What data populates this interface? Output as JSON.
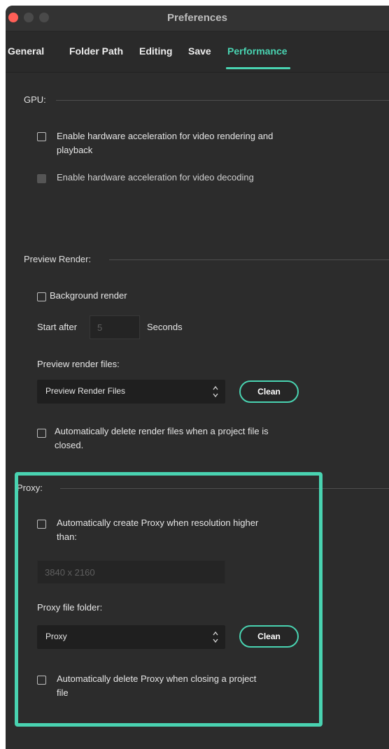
{
  "window": {
    "title": "Preferences"
  },
  "tabs": [
    {
      "label": "General",
      "active": false
    },
    {
      "label": "Folder Path",
      "active": false
    },
    {
      "label": "Editing",
      "active": false
    },
    {
      "label": "Save",
      "active": false
    },
    {
      "label": "Performance",
      "active": true
    }
  ],
  "gpu": {
    "label": "GPU:",
    "options": [
      {
        "label": "Enable hardware acceleration for video rendering and playback",
        "checked": false,
        "enabled": true
      },
      {
        "label": "Enable hardware acceleration for video decoding",
        "checked": false,
        "enabled": false
      }
    ]
  },
  "preview_render": {
    "label": "Preview Render:",
    "background_render": {
      "label": "Background render",
      "checked": false
    },
    "start_after_label": "Start after",
    "start_after_value": "5",
    "seconds_label": "Seconds",
    "files_label": "Preview render files:",
    "files_value": "Preview Render Files",
    "clean_label": "Clean",
    "auto_delete": {
      "label": "Automatically delete render files when a project file is closed.",
      "checked": false
    }
  },
  "proxy": {
    "label": "Proxy:",
    "auto_create": {
      "label": "Automatically create Proxy when resolution higher than:",
      "checked": false
    },
    "resolution_value": "3840 x 2160",
    "folder_label": "Proxy file folder:",
    "folder_value": "Proxy",
    "clean_label": "Clean",
    "auto_delete": {
      "label": "Automatically delete Proxy when closing a project file",
      "checked": false
    }
  },
  "colors": {
    "accent": "#49d3b1",
    "background": "#2c2c2c",
    "close_light": "#ff5f57"
  }
}
